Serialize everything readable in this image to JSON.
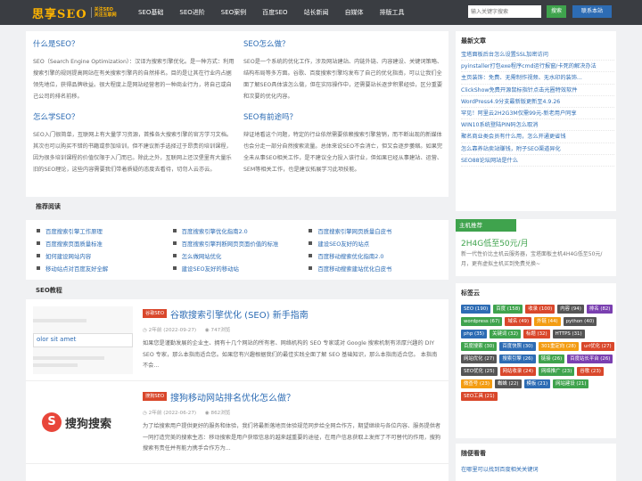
{
  "header": {
    "logo_main": "思享SEO",
    "logo_sub_1": "关注SEO",
    "logo_sub_2": "关注互联网",
    "nav": [
      "SEO基础",
      "SEO进阶",
      "SEO案例",
      "百度SEO",
      "站长新闻",
      "自媒体",
      "排版工具"
    ],
    "search_placeholder": "输入关键字搜索",
    "search_button": "搜索",
    "contact_button": "联系本站"
  },
  "intro": [
    {
      "title": "什么是SEO？",
      "text": "SEO（Search Engine Optimization）：汉译为搜索引擎优化。是一种方式：利用搜索引擎的规则提高网站在有关搜索引擎内的自然排名。目的是让其在行业内占据领先地位，获得品牌收益。很大程度上是网站经营者的一种商业行为，将自己或自己公司的排名前移。"
    },
    {
      "title": "SEO怎么做？",
      "text": "SEO是一个系统的优化工作，涉及网站建站、内链外链、内容建设、关键词策略、结构布局等多方面。谷歌、百度搜索引擎均发布了自己的优化指南，可以让我们全面了解SEO具体该怎么做，但在实际操作中，还需要站长逐步积累经验，区分重要和次要的优化内容。"
    },
    {
      "title": "怎么学SEO？",
      "text": "SEO入门很简单，互联网上有大量学习资源，首推各大搜索引擎的官方学习文档。其次也可以购买不错的书籍或参加培训，但不建议新手选择过于昂贵的培训课程，因为很多培训课程的价值仅限于入门而已。除此之外，互联网上还汉堡里有大量乐旧的SEO理论，这些内容需要我们带着质疑的态度去看待，切勿人云亦云。"
    },
    {
      "title": "SEO有前途吗？",
      "text": "辩证地看这个问题，特定的行业依然需要依赖搜索引擎营销，而不断出现的新媒体也会分走一部分自然搜索流量。总体来说SEO不会消亡，但又会逐步萎缩。如果完全未从事SEO相关工作，是不建议全力投入该行业，但如果已经从事建站、运营、SEM等相关工作，也是建议拓展学习此项技能。"
    }
  ],
  "recommend": {
    "title": "推荐阅读",
    "items": [
      "百度搜索引擎工作原理",
      "百度搜索引擎优化指南2.0",
      "百度搜索引擎网页质量白皮书",
      "百度搜索页面质量标准",
      "百度搜索引擎判断网页页面价值的标准",
      "建设SEO友好的站点",
      "如何建设网站内容",
      "怎么做网站优化",
      "百度移动搜索优化指南2.0",
      "移动站点对百度友好全解",
      "建设SEO友好的移动站",
      "百度移动搜索建站优化白皮书"
    ]
  },
  "articles": {
    "title": "SEO教程",
    "posts": [
      {
        "category": "谷歌SEO",
        "title": "谷歌搜索引擎优化 (SEO) 新手指南",
        "date": "2年前 (2022-09-27)",
        "views": "747浏览",
        "excerpt": "如果您是谨勤发展的企业主、拥有十几个网站的所有者、网络机构的 SEO 专家或对 Google 搜索机制有浓厚兴趣的 DIY SEO 专家，那么本指南适合您。如果您有兴趣根据我们的最佳实践全面了解 SEO 基础知识，那么本指南适合您。 本指南不会...",
        "thumb_text": "olor sit amet"
      },
      {
        "category": "搜狗SEO",
        "title": "搜狗移动网站排名优化怎么做？",
        "date": "2年前 (2022-06-27)",
        "views": "862浏览",
        "excerpt": "为了给搜索用户提供更好的服务和体验，我们将最新落地页体验规范同步给全网合作方，期望继续与各位内容、服务提供者一同打造完美的搜索生态：移动搜索是用户获取信息的越来越重要的途径，在用户信息获取上发挥了不可替代的作用，搜狗搜索有责任并有能力携手合作方为...",
        "thumb_text": "搜狗搜索"
      }
    ]
  },
  "sidebar": {
    "news_title": "最新文章",
    "news": [
      "宝塔面板后台怎么设置SSL加密访问",
      "pyinstaller打包exe程序cmd运行报窗/卡死的解决办法",
      "主页装饰：免费、无需制作视频、无水印的装饰...",
      "ClickShow免费开源鼠标指针点击光圈特效软件",
      "WordPress4.9分支最新版更新至4.9.26",
      "罕见！阿里云2H2G3M仅需99元-新老用户同享",
      "WIN10系统登陆PIN码怎么取消",
      "聚名商业类会员有什么用，怎么开通更省钱",
      "怎么靠养站卖站赚钱，附子SEO渠道异化",
      "SEO88论坛网站是什么"
    ],
    "host_title": "主机推荐",
    "host_headline": "2H4G低至50元/月",
    "host_desc": "新一代性价比主机云服务器，宝塔面板主机4H4G低至50元/月，更有虚拟主机买到免费兑换~",
    "tags_title": "标签云",
    "tags": [
      {
        "label": "SEO (190)",
        "color": "#2d6cb4"
      },
      {
        "label": "百度 (158)",
        "color": "#3fa34d"
      },
      {
        "label": "收录 (100)",
        "color": "#d9472b"
      },
      {
        "label": "内容 (94)",
        "color": "#555555"
      },
      {
        "label": "排名 (82)",
        "color": "#7a3fb0"
      },
      {
        "label": "wordpress (67)",
        "color": "#3fa34d"
      },
      {
        "label": "域名 (49)",
        "color": "#d9472b"
      },
      {
        "label": "外链 (44)",
        "color": "#f39c12"
      },
      {
        "label": "python (40)",
        "color": "#555555"
      },
      {
        "label": "php (35)",
        "color": "#2d6cb4"
      },
      {
        "label": "关键词 (32)",
        "color": "#3fa34d"
      },
      {
        "label": "标题 (32)",
        "color": "#d9472b"
      },
      {
        "label": "HTTPS (31)",
        "color": "#555555"
      },
      {
        "label": "百度搜索 (30)",
        "color": "#3fa34d"
      },
      {
        "label": "百度快照 (30)",
        "color": "#2d6cb4"
      },
      {
        "label": "301重定向 (28)",
        "color": "#f39c12"
      },
      {
        "label": "url优化 (27)",
        "color": "#d9472b"
      },
      {
        "label": "网站优化 (27)",
        "color": "#555555"
      },
      {
        "label": "搜索引擎 (26)",
        "color": "#2d6cb4"
      },
      {
        "label": "链接 (26)",
        "color": "#3fa34d"
      },
      {
        "label": "百度站长平台 (26)",
        "color": "#7a3fb0"
      },
      {
        "label": "SEO优化 (25)",
        "color": "#555555"
      },
      {
        "label": "网站收录 (24)",
        "color": "#d9472b"
      },
      {
        "label": "网络推广 (23)",
        "color": "#3fa34d"
      },
      {
        "label": "谷歌 (23)",
        "color": "#d9472b"
      },
      {
        "label": "微查号 (23)",
        "color": "#f39c12"
      },
      {
        "label": "蜘蛛 (22)",
        "color": "#555555"
      },
      {
        "label": "模板 (21)",
        "color": "#2d6cb4"
      },
      {
        "label": "网站建设 (21)",
        "color": "#3fa34d"
      },
      {
        "label": "SEO工具 (21)",
        "color": "#d9472b"
      }
    ],
    "random_title": "随便看看",
    "random_first": "在哪里可以找到百度相关关键词"
  }
}
